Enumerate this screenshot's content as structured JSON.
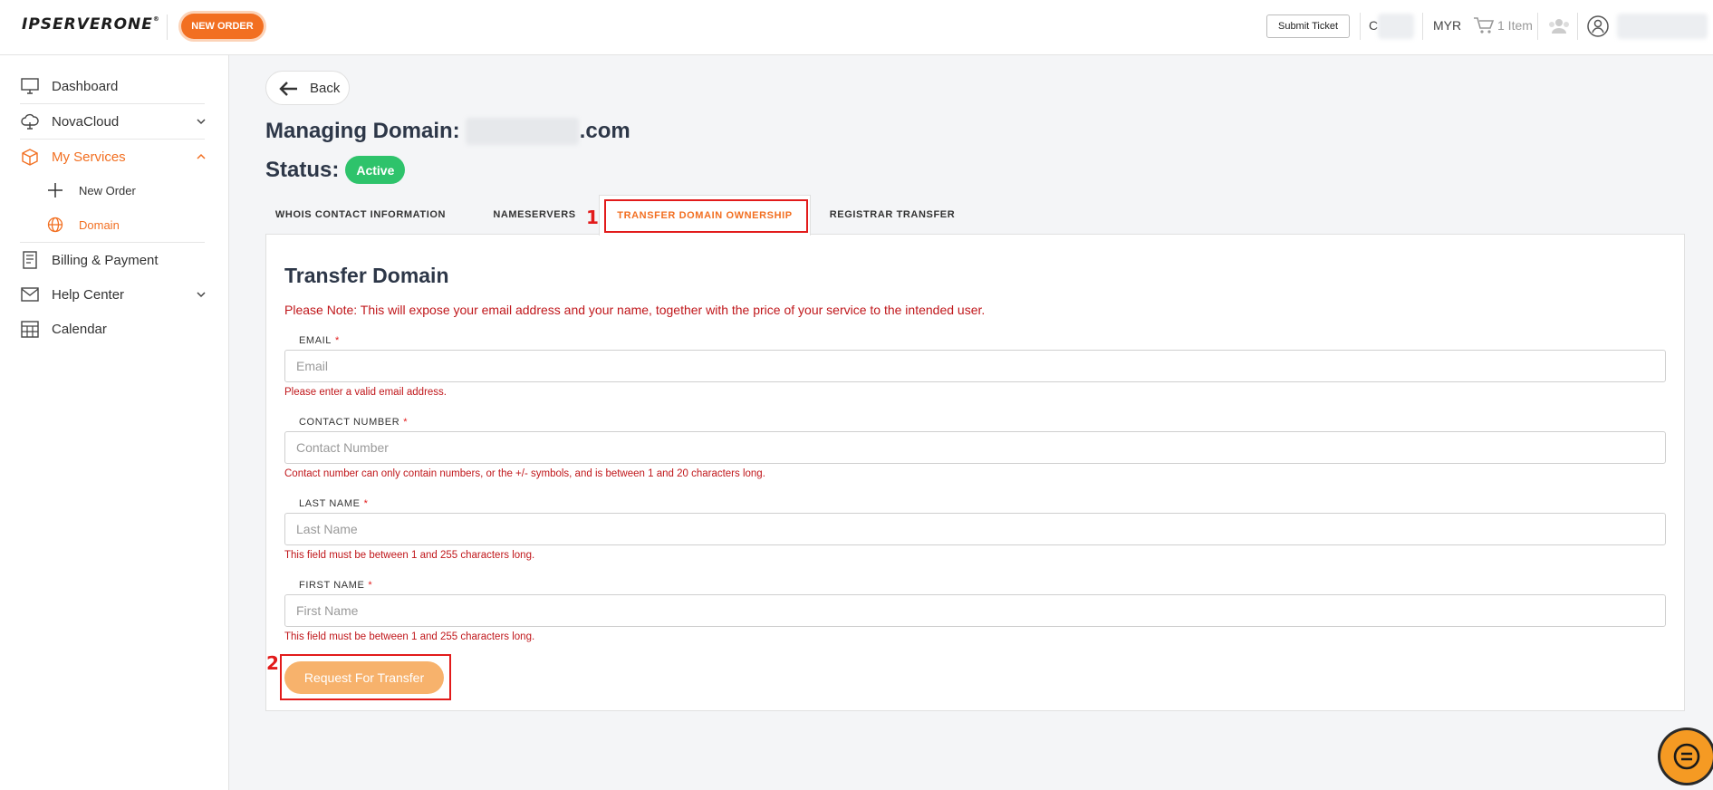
{
  "header": {
    "logo_text": "IPSERVERONE",
    "logo_tm": "®",
    "new_order_label": "NEW ORDER",
    "submit_ticket_label": "Submit Ticket",
    "currency_prefix": "C",
    "currency": "MYR",
    "cart_label": "1 Item"
  },
  "sidebar": {
    "items": [
      {
        "label": "Dashboard",
        "icon": "monitor-icon"
      },
      {
        "label": "NovaCloud",
        "icon": "cloud-icon"
      },
      {
        "label": "My Services",
        "icon": "box-icon"
      },
      {
        "label": "Billing & Payment",
        "icon": "invoice-icon"
      },
      {
        "label": "Help Center",
        "icon": "envelope-icon"
      },
      {
        "label": "Calendar",
        "icon": "calendar-icon"
      }
    ],
    "subitems": [
      {
        "label": "New Order",
        "icon": "plus-icon"
      },
      {
        "label": "Domain",
        "icon": "globe-icon"
      }
    ]
  },
  "main": {
    "back_label": "Back",
    "managing_prefix": "Managing Domain:",
    "domain_suffix": ".com",
    "status_label": "Status:",
    "status_value": "Active",
    "tabs": [
      {
        "label": "WHOIS CONTACT INFORMATION"
      },
      {
        "label": "NAMESERVERS"
      },
      {
        "label": "TRANSFER DOMAIN OWNERSHIP"
      },
      {
        "label": "REGISTRAR TRANSFER"
      }
    ],
    "annotations": {
      "one": "1",
      "two": "2"
    },
    "form": {
      "title": "Transfer Domain",
      "note": "Please Note: This will expose your email address and your name, together with the price of your service to the intended user.",
      "required_mark": "*",
      "fields": [
        {
          "label": "EMAIL",
          "placeholder": "Email",
          "value": "",
          "error": "Please enter a valid email address."
        },
        {
          "label": "CONTACT NUMBER",
          "placeholder": "Contact Number",
          "value": "",
          "error": "Contact number can only contain numbers, or the +/- symbols, and is between 1 and 20 characters long."
        },
        {
          "label": "LAST NAME",
          "placeholder": "Last Name",
          "value": "",
          "error": "This field must be between 1 and 255 characters long."
        },
        {
          "label": "FIRST NAME",
          "placeholder": "First Name",
          "value": "",
          "error": "This field must be between 1 and 255 characters long."
        }
      ],
      "submit_label": "Request For Transfer"
    }
  },
  "colors": {
    "accent": "#f26f21",
    "error": "#c0171b",
    "success": "#2ec36b",
    "annotation": "#e21b1b"
  }
}
